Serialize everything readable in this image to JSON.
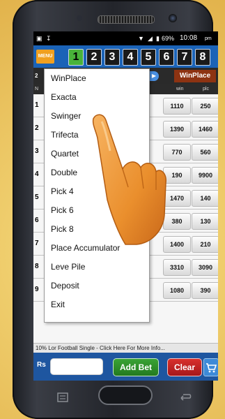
{
  "status_bar": {
    "battery": "69%",
    "time": "10:08",
    "time_suffix": "pm"
  },
  "top_nav": {
    "menu_label": "MENU",
    "race_numbers": [
      "1",
      "2",
      "3",
      "4",
      "5",
      "6",
      "7",
      "8"
    ],
    "active_race": "1"
  },
  "race_header": {
    "partial_number": "2",
    "bet_type_tag": "WinPlace"
  },
  "columns": {
    "num": "N",
    "win": "win",
    "plc": "plc"
  },
  "runners": [
    {
      "num": "1",
      "win": "1110",
      "plc": "250"
    },
    {
      "num": "2",
      "win": "1390",
      "plc": "1460"
    },
    {
      "num": "3",
      "win": "770",
      "plc": "560"
    },
    {
      "num": "4",
      "win": "190",
      "plc": "9900"
    },
    {
      "num": "5",
      "win": "1470",
      "plc": "140"
    },
    {
      "num": "6",
      "win": "380",
      "plc": "130"
    },
    {
      "num": "7",
      "win": "1400",
      "plc": "210"
    },
    {
      "num": "8",
      "win": "3310",
      "plc": "3090"
    },
    {
      "num": "9",
      "win": "1080",
      "plc": "390"
    }
  ],
  "menu_items": [
    "WinPlace",
    "Exacta",
    "Swinger",
    "Trifecta",
    "Quartet",
    "Double",
    "Pick 4",
    "Pick 6",
    "Pick 8",
    "Place Accumulator",
    "Leve Pile",
    "Deposit",
    "Exit"
  ],
  "ticker": "10% Lor Football Single - Click Here For More Info...",
  "bottom_bar": {
    "rs_label": "Rs",
    "add_bet_label": "Add Bet",
    "clear_label": "Clear"
  },
  "colors": {
    "accent_blue": "#1b63b7",
    "add_bet_green": "#2f8f2b",
    "clear_red": "#c02424",
    "active_race_green": "#49b33a",
    "tag_brown": "#8d3312"
  }
}
